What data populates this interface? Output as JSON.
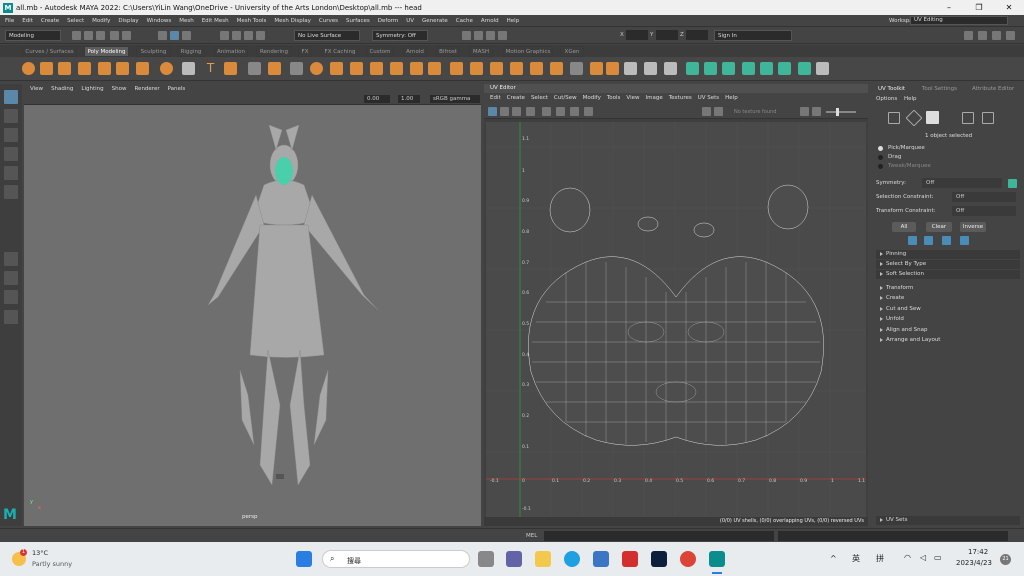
{
  "title": {
    "text": "all.mb - Autodesk MAYA 2022: C:\\Users\\YiLin Wang\\OneDrive - University of the Arts London\\Desktop\\all.mb  ---  head",
    "min": "–",
    "max": "❐",
    "close": "✕"
  },
  "menu": [
    "File",
    "Edit",
    "Create",
    "Select",
    "Modify",
    "Display",
    "Windows",
    "Mesh",
    "Edit Mesh",
    "Mesh Tools",
    "Mesh Display",
    "Curves",
    "Surfaces",
    "Deform",
    "UV",
    "Generate",
    "Cache",
    "Arnold",
    "Help"
  ],
  "workspace": {
    "label": "Workspace :",
    "value": "UV Editing"
  },
  "status": {
    "mode": "Modeling",
    "live": "No Live Surface",
    "symmetry": "Symmetry: Off",
    "x": "X",
    "y": "Y",
    "z": "Z",
    "signin": "Sign In"
  },
  "shelf_tabs": [
    "Curves / Surfaces",
    "Poly Modeling",
    "Sculpting",
    "Rigging",
    "Animation",
    "Rendering",
    "FX",
    "FX Caching",
    "Custom",
    "Arnold",
    "Bifrost",
    "MASH",
    "Motion Graphics",
    "XGen"
  ],
  "viewport": {
    "menus": [
      "View",
      "Shading",
      "Lighting",
      "Show",
      "Renderer",
      "Panels"
    ],
    "val1": "0.00",
    "val2": "1.00",
    "gamma": "sRGB gamma (leg",
    "camera": "persp",
    "axis_y": "y",
    "axis_x": "x"
  },
  "uv": {
    "title": "UV Editor",
    "menus": [
      "Edit",
      "Create",
      "Select",
      "Cut/Sew",
      "Modify",
      "Tools",
      "View",
      "Image",
      "Textures",
      "UV Sets",
      "Help"
    ],
    "no_texture": "No texture found",
    "status": "(0/0) UV shells, (0/0) overlapping UVs, (0/0) reversed UVs",
    "xticks": [
      "-0.1",
      "0",
      "0.1",
      "0.2",
      "0.3",
      "0.4",
      "0.5",
      "0.6",
      "0.7",
      "0.8",
      "0.9",
      "1",
      "1.1"
    ],
    "yticks": [
      "1.1",
      "1",
      "0.9",
      "0.8",
      "0.7",
      "0.6",
      "0.5",
      "0.4",
      "0.3",
      "0.2",
      "0.1",
      "-0.1"
    ]
  },
  "panel": {
    "tabs": [
      "UV Toolkit",
      "Tool Settings",
      "Attribute Editor"
    ],
    "menus": [
      "Options",
      "Help"
    ],
    "selected": "1 object selected",
    "pick": "Pick/Marquee",
    "drag": "Drag",
    "tweak": "Tweak/Marquee",
    "symmetry_label": "Symmetry:",
    "symmetry_value": "Off",
    "selc_label": "Selection Constraint:",
    "selc_value": "Off",
    "tranc_label": "Transform Constraint:",
    "tranc_value": "Off",
    "all": "All",
    "clear": "Clear",
    "inverse": "Inverse",
    "sub": [
      "Pinning",
      "Select By Type",
      "Soft Selection"
    ],
    "sections": [
      "Transform",
      "Create",
      "Cut and Sew",
      "Unfold",
      "Align and Snap",
      "Arrange and Layout"
    ],
    "uvsets": "UV Sets"
  },
  "cmd": {
    "mel": "MEL"
  },
  "taskbar": {
    "temp": "13°C",
    "weather": "Partly sunny",
    "search": "搜尋",
    "ime1": "英",
    "ime2": "拼",
    "time": "17:42",
    "date": "2023/4/23",
    "badge": "21"
  }
}
